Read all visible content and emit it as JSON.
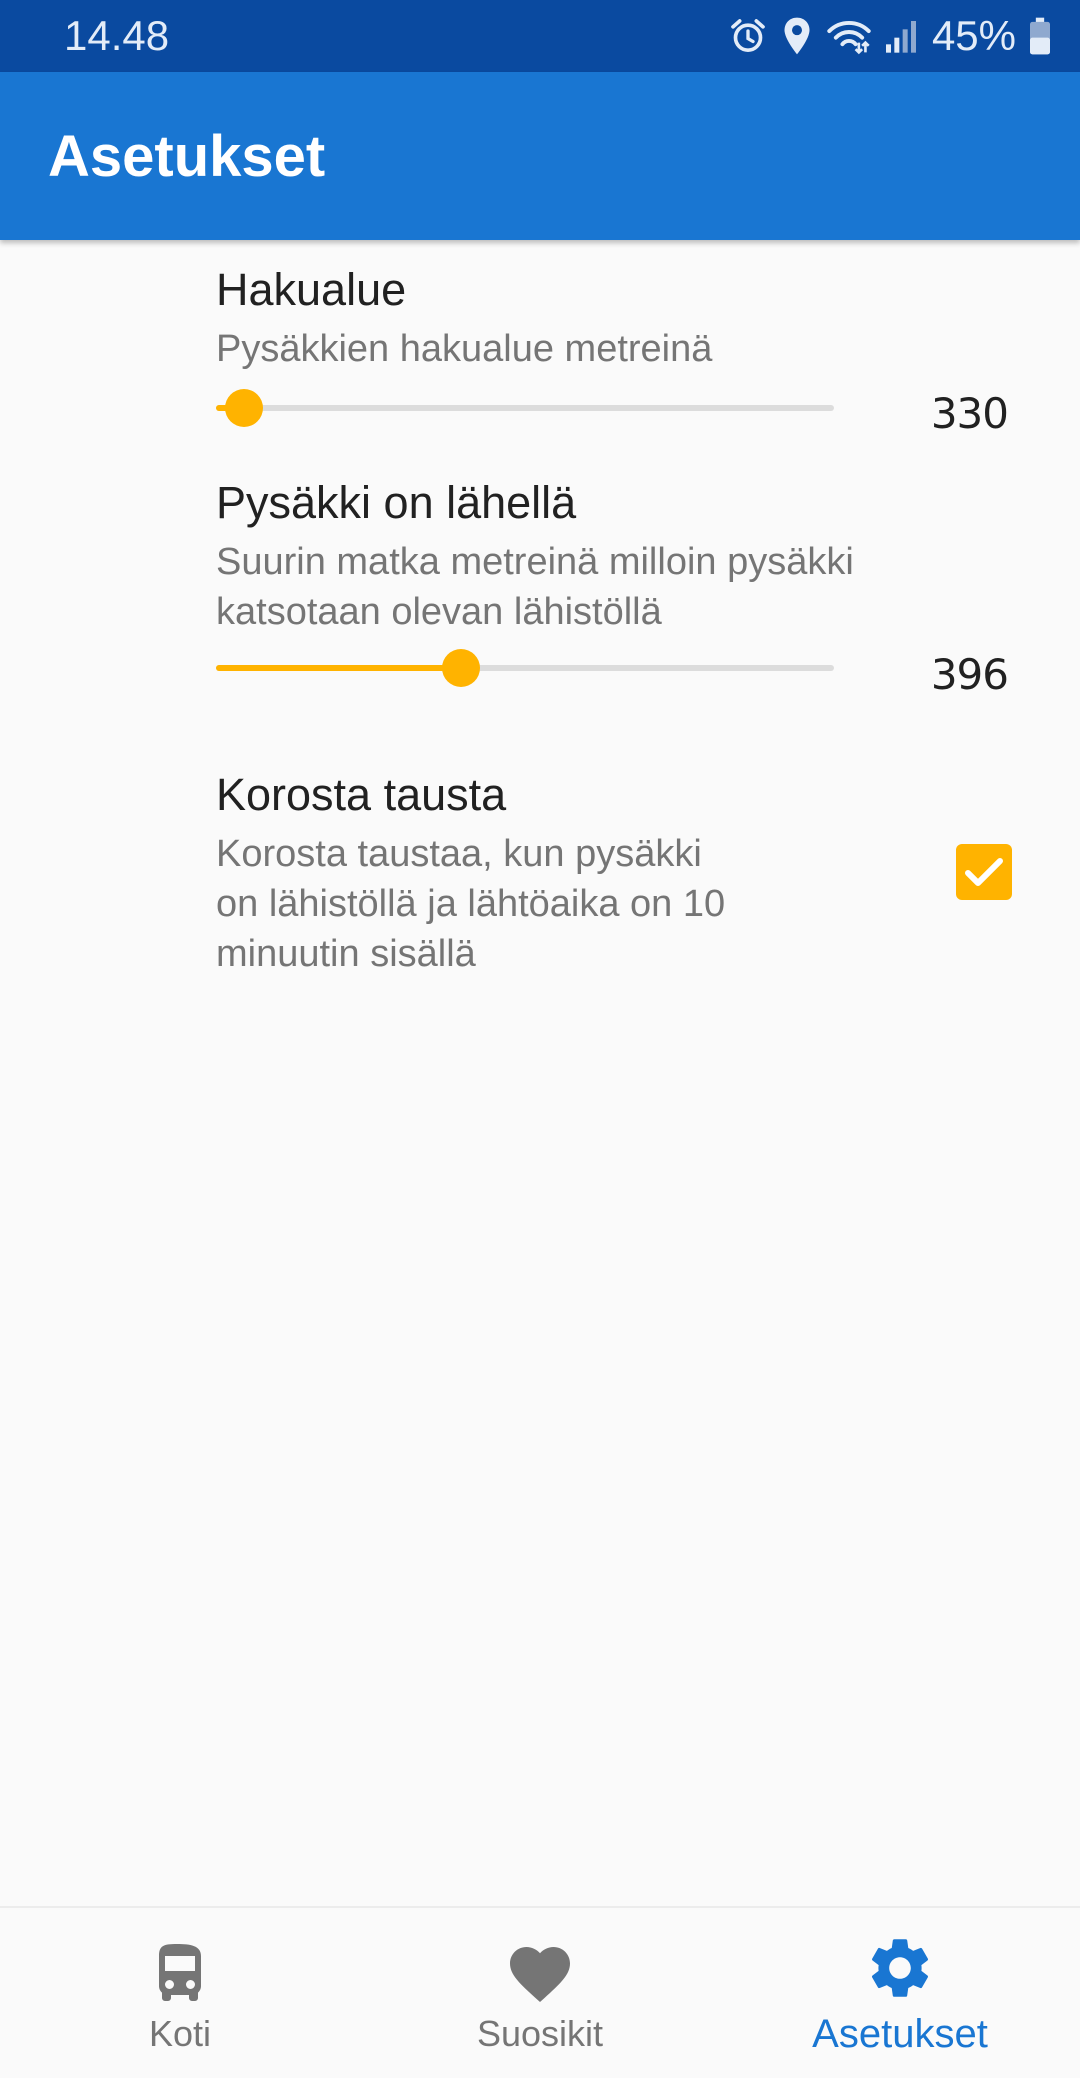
{
  "status_bar": {
    "time": "14.48",
    "battery": "45%",
    "icons": [
      "alarm-icon",
      "location-icon",
      "wifi-icon",
      "signal-icon",
      "battery-icon"
    ]
  },
  "app_bar": {
    "title": "Asetukset"
  },
  "preferences": {
    "search_area": {
      "title": "Hakualue",
      "summary": "Pysäkkien hakualue metreinä",
      "value": "330",
      "slider_fraction": 0.045
    },
    "stop_nearby": {
      "title": "Pysäkki on lähellä",
      "summary_line1": "Suurin matka metreinä milloin pysäkki",
      "summary_line2": "katsotaan olevan lähistöllä",
      "value": "396",
      "slider_fraction": 0.397
    },
    "highlight_background": {
      "title": "Korosta tausta",
      "summary_line1": "Korosta taustaa, kun pysäkki",
      "summary_line2": "on lähistöllä ja lähtöaika on 10",
      "summary_line3": "minuutin sisällä",
      "checked": true
    }
  },
  "colors": {
    "status_bar": "#0a4aa0",
    "app_bar": "#1976d2",
    "accent": "#ffb300",
    "nav_active": "#1976d2",
    "nav_inactive": "#757575"
  },
  "bottom_nav": {
    "items": [
      {
        "label": "Koti",
        "icon": "bus-icon",
        "active": false
      },
      {
        "label": "Suosikit",
        "icon": "heart-icon",
        "active": false
      },
      {
        "label": "Asetukset",
        "icon": "gear-icon",
        "active": true
      }
    ]
  }
}
